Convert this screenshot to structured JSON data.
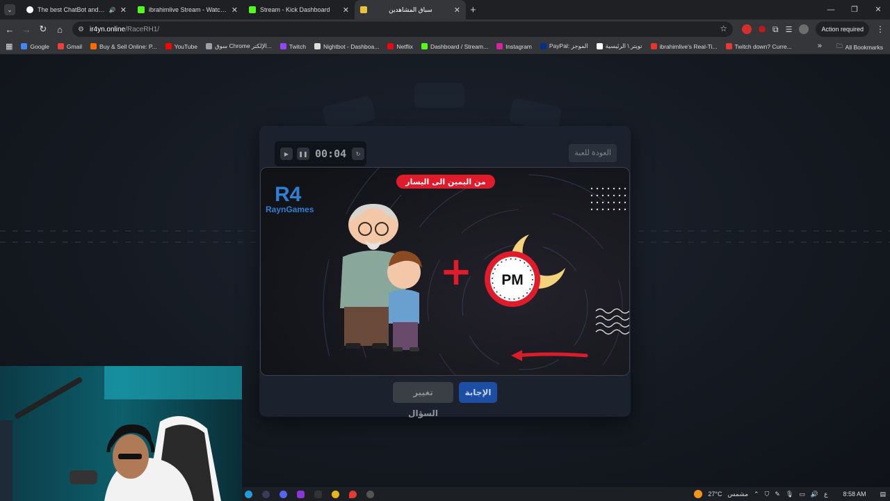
{
  "browser": {
    "tabs": [
      {
        "title": "The best ChatBot and Widg",
        "favicon_color": "#ffffff",
        "audio": "🔊"
      },
      {
        "title": "ibrahimlive Stream - Watch Live",
        "favicon_color": "#53fc18"
      },
      {
        "title": "Stream - Kick Dashboard",
        "favicon_color": "#53fc18"
      },
      {
        "title": "سباق المشاهدين",
        "favicon_color": "#e8c23a",
        "active": true
      }
    ],
    "url_host": "ir4yn.online",
    "url_path": "/RaceRH1/",
    "action_required": "Action required",
    "bookmarks": [
      {
        "label": "Google",
        "color": "#4285f4"
      },
      {
        "label": "Gmail",
        "color": "#ea4335"
      },
      {
        "label": "Buy & Sell Online: P...",
        "color": "#ff6a00"
      },
      {
        "label": "YouTube",
        "color": "#ff0000"
      },
      {
        "label": "سوق Chrome الإلكتر...",
        "color": "#9aa0a6"
      },
      {
        "label": "Twitch",
        "color": "#9146ff"
      },
      {
        "label": "Nightbot - Dashboa...",
        "color": "#dddddd"
      },
      {
        "label": "Netflix",
        "color": "#e50914"
      },
      {
        "label": "Dashboard / Stream...",
        "color": "#53fc18"
      },
      {
        "label": "Instagram",
        "color": "#d6249f"
      },
      {
        "label": "PayPal: الموجز",
        "color": "#003087"
      },
      {
        "label": "تويتر \\ الرئيسية",
        "color": "#ffffff"
      },
      {
        "label": "ibrahimlive's Real-Ti...",
        "color": "#e5352b"
      },
      {
        "label": "Twitch down? Curre...",
        "color": "#e53935"
      }
    ],
    "all_bookmarks": "All Bookmarks"
  },
  "game": {
    "timer": "00:04",
    "back_button": "العودة للعبة",
    "direction_banner": "من اليمين الى اليسار",
    "brand_top": "R4",
    "brand_name": "RaynGames",
    "plus_sign": "+",
    "clock_label": "PM",
    "change_question": "تغيير السؤال",
    "answer": "الإجابة"
  },
  "taskbar": {
    "temperature": "27°C",
    "weather": "مشمس",
    "lang": "ع",
    "time": "8:58 AM"
  },
  "colors": {
    "accent_red": "#e01c2c",
    "answer_blue": "#1c4fa3"
  }
}
